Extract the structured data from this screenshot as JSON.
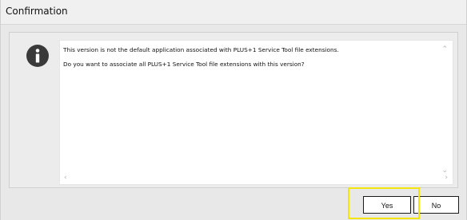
{
  "window": {
    "title": "Confirmation"
  },
  "message": {
    "line1": "This version is not the default application associated with PLUS+1 Service Tool file extensions.",
    "line2": "Do you want to associate all PLUS+1 Service Tool file extensions with this version?"
  },
  "icons": {
    "info": "info-icon",
    "scroll_up": "chevron-up-icon",
    "scroll_down": "chevron-down-icon",
    "scroll_left": "chevron-left-icon",
    "scroll_right": "chevron-right-icon"
  },
  "buttons": {
    "yes_label": "Yes",
    "no_label": "No"
  },
  "colors": {
    "highlight": "#f2e40c",
    "dialog_bg": "#e8e8e8",
    "icon": "#3a3a3a"
  }
}
